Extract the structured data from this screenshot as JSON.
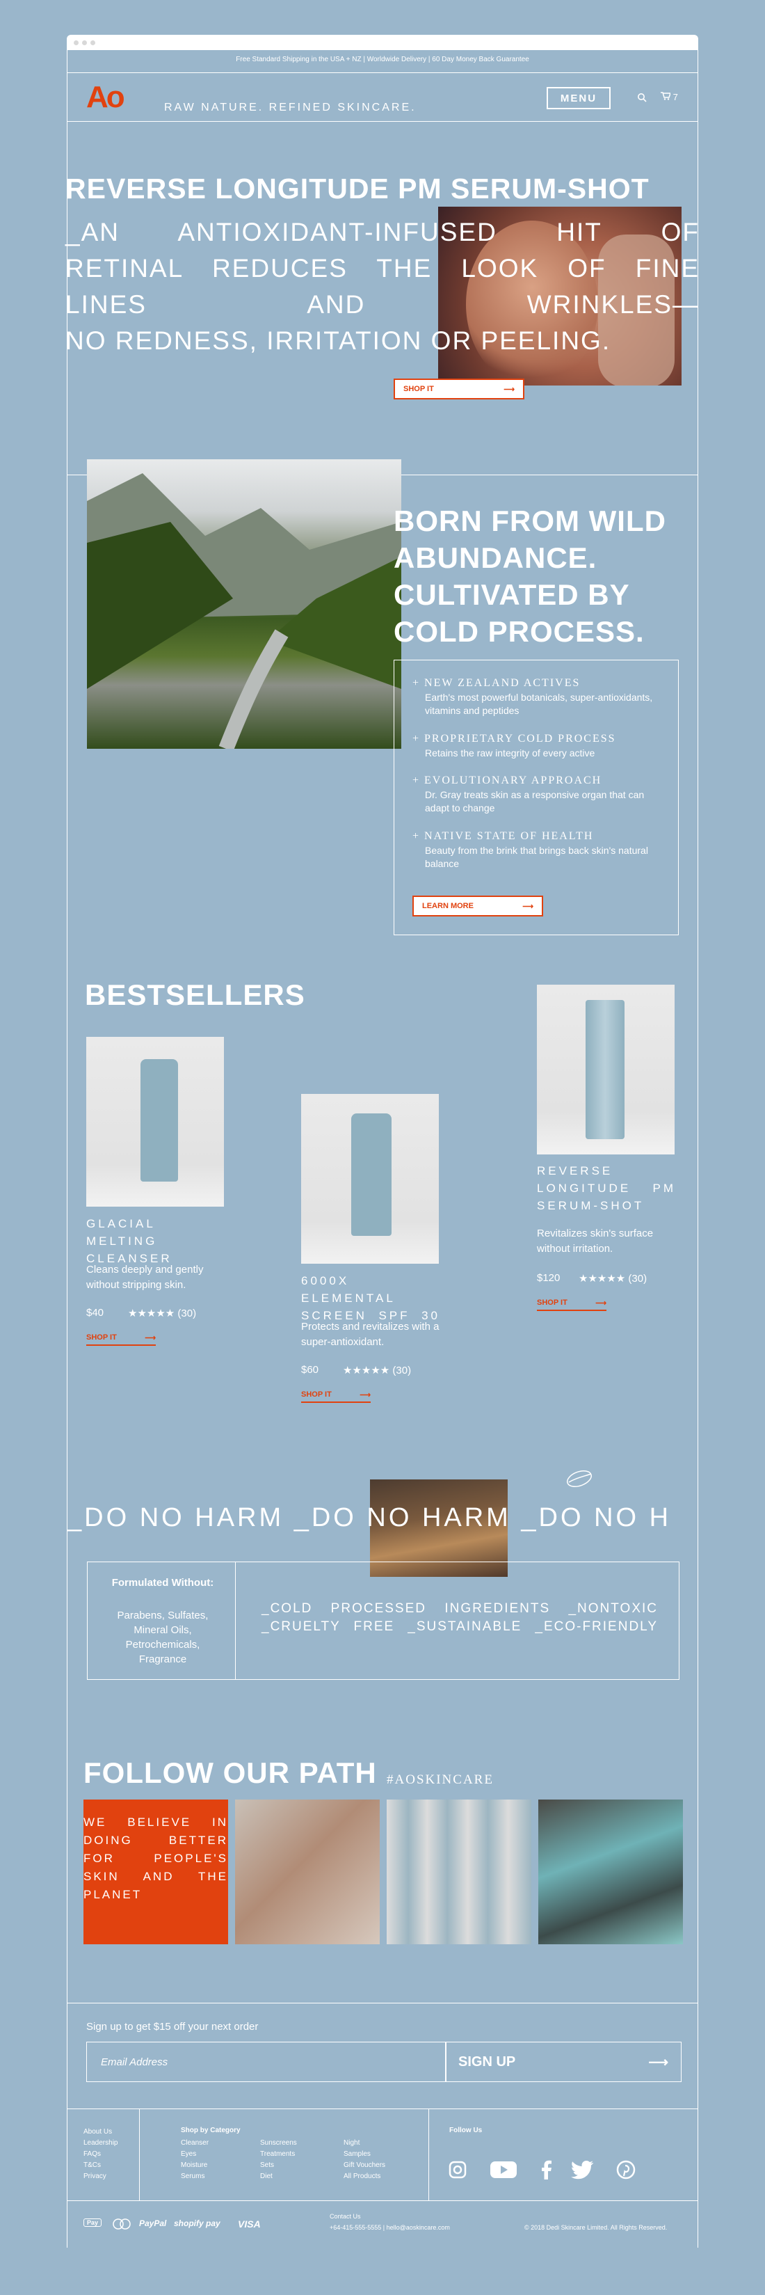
{
  "promo_bar": "Free Standard Shipping in the USA + NZ  |  Worldwide Delivery  |  60 Day Money Back Guarantee",
  "header": {
    "logo": "Ao",
    "tagline": "RAW NATURE. REFINED SKINCARE.",
    "menu_label": "MENU",
    "cart_count": "7"
  },
  "hero": {
    "title": "REVERSE LONGITUDE PM SERUM-SHOT",
    "lines": [
      "_AN ANTIOXIDANT-INFUSED HIT OF",
      "RETINAL REDUCES THE LOOK OF FINE",
      "LINES AND WRINKLES—",
      "NO REDNESS, IRRITATION OR PEELING."
    ],
    "cta": "SHOP IT"
  },
  "origin": {
    "title": "BORN FROM WILD ABUNDANCE. CULTIVATED BY COLD PROCESS.",
    "features": [
      {
        "title": "NEW ZEALAND ACTIVES",
        "desc": "Earth's most powerful botanicals, super-antioxidants, vitamins and peptides"
      },
      {
        "title": "PROPRIETARY COLD PROCESS",
        "desc": "Retains the raw integrity of every active"
      },
      {
        "title": "EVOLUTIONARY APPROACH",
        "desc": "Dr. Gray treats skin as a responsive organ that can adapt to change"
      },
      {
        "title": "NATIVE STATE OF HEALTH",
        "desc": "Beauty from the brink that brings back skin's natural balance"
      }
    ],
    "cta": "LEARN MORE"
  },
  "bestsellers": {
    "title": "BESTSELLERS",
    "products": [
      {
        "name": "GLACIAL MELTING CLEANSER",
        "desc": "Cleans deeply and gently without stripping skin.",
        "price": "$40",
        "stars": "★★★★★",
        "reviews": "(30)",
        "cta": "SHOP IT",
        "rating": 5
      },
      {
        "name": "6000X ELEMENTAL SCREEN SPF 30",
        "desc": "Protects and revitalizes with a super-antioxidant.",
        "price": "$60",
        "stars": "★★★★★",
        "reviews": "(30)",
        "cta": "SHOP IT",
        "rating": 5
      },
      {
        "name": "REVERSE LONGITUDE PM SERUM-SHOT",
        "desc": "Revitalizes skin's surface without irritation.",
        "price": "$120",
        "stars": "★★★★★",
        "reviews": "(30)",
        "cta": "SHOP IT",
        "rating": 5
      }
    ]
  },
  "harm": {
    "marquee": "_DO NO HARM   _DO NO HARM   _DO NO H",
    "formulated_title": "Formulated Without:",
    "formulated_list": "Parabens, Sulfates, Mineral Oils, Petrochemicals, Fragrance",
    "values_line1": "_COLD PROCESSED INGREDIENTS _NONTOXIC",
    "values_line2": "_CRUELTY FREE _SUSTAINABLE _ECO-FRIENDLY"
  },
  "path": {
    "title": "FOLLOW OUR PATH",
    "hashtag": "#AOSKINCARE",
    "quote": "WE BELIEVE IN DOING BETTER FOR PEOPLE'S SKIN AND THE PLANET"
  },
  "signup": {
    "label": "Sign up to get $15 off your next order",
    "placeholder": "Email Address",
    "button": "SIGN UP"
  },
  "footer": {
    "col1": [
      "About Us",
      "Leadership",
      "FAQs",
      "T&Cs",
      "Privacy"
    ],
    "category_title": "Shop by Category",
    "col2": [
      "Cleanser",
      "Eyes",
      "Moisture",
      "Serums"
    ],
    "col3": [
      "Sunscreens",
      "Treatments",
      "Sets",
      "Diet"
    ],
    "col4": [
      "Night",
      "Samples",
      "Gift Vouchers",
      "All Products"
    ],
    "follow_title": "Follow Us",
    "contact_title": "Contact Us",
    "contact_line": "+64-415-555-5555 | hello@aoskincare.com",
    "copyright": "© 2018 Dedi Skincare Limited. All Rights Reserved.",
    "payments": [
      "Pay",
      "PayPal",
      "shopify pay",
      "VISA"
    ]
  },
  "colors": {
    "accent": "#e1420f",
    "background": "#9ab6cb"
  }
}
